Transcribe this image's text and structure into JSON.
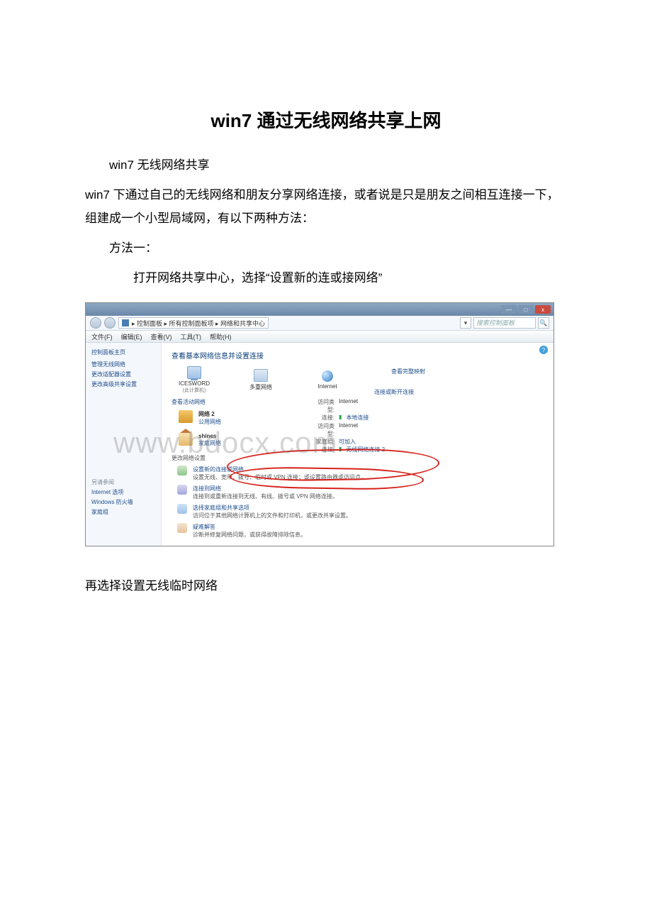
{
  "doc": {
    "title": "win7 通过无线网络共享上网",
    "p1": "win7 无线网络共享",
    "p2": "win7 下通过自己的无线网络和朋友分享网络连接，或者说是只是朋友之间相互连接一下，组建成一个小型局域网，有以下两种方法：",
    "p3": "方法一：",
    "p4": "　　打开网络共享中心，选择“设置新的连或接网络”",
    "p5": "再选择设置无线临时网络"
  },
  "win": {
    "btn_min": "—",
    "btn_max": "□",
    "btn_close": "x",
    "breadcrumb": "▸ 控制面板 ▸ 所有控制面板项 ▸ 网络和共享中心",
    "search_placeholder": "搜索控制面板",
    "search_dropdown": "▾",
    "search_go": "🔍",
    "menu": {
      "file": "文件(F)",
      "edit": "编辑(E)",
      "view": "查看(V)",
      "tools": "工具(T)",
      "help": "帮助(H)"
    },
    "help_icon": "?"
  },
  "sidebar": {
    "home": "控制面板主页",
    "links": [
      "管理无线网络",
      "更改适配器设置",
      "更改高级共享设置"
    ],
    "see_also_title": "另请参阅",
    "see_also": [
      "Internet 选项",
      "Windows 防火墙",
      "家庭组"
    ]
  },
  "main": {
    "heading": "查看基本网络信息并设置连接",
    "map_link": "查看完整映射",
    "nodes": {
      "pc_name": "ICESWORD",
      "pc_sub": "(此计算机)",
      "multi": "多重网络",
      "internet": "Internet"
    },
    "active_title": "查看活动网络",
    "conn_link": "连接或断开连接",
    "net1": {
      "name": "网络 2",
      "type": "公用网络",
      "props": [
        {
          "label": "访问类型:",
          "value": "Internet"
        },
        {
          "label": "连接:",
          "value": "本地连接",
          "link": true,
          "sig": true
        }
      ]
    },
    "net2": {
      "name": "shines",
      "type": "家庭网络",
      "props": [
        {
          "label": "访问类型:",
          "value": "Internet"
        },
        {
          "label": "家庭组:",
          "value": "可加入",
          "link": true
        },
        {
          "label": "连接:",
          "value": "无线网络连接 2",
          "link": true,
          "sig": true
        }
      ]
    },
    "settings_title": "更改网络设置",
    "actions": [
      {
        "title": "设置新的连接或网络",
        "desc": "设置无线、宽带、拨号、临时或 VPN 连接；或设置路由器或访问点。"
      },
      {
        "title": "连接到网络",
        "desc": "连接到或重新连接到无线、有线、拨号或 VPN 网络连接。"
      },
      {
        "title": "选择家庭组和共享选项",
        "desc": "访问位于其他网络计算机上的文件和打印机，或更改共享设置。"
      },
      {
        "title": "疑难解答",
        "desc": "诊断并修复网络问题，或获得故障排除信息。"
      }
    ]
  },
  "watermark": "www.bdocx.com"
}
